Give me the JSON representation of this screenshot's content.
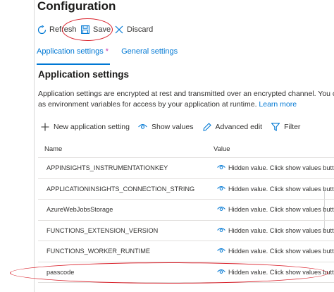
{
  "page": {
    "title": "Configuration",
    "section_title": "Application settings",
    "description": "Application settings are encrypted at rest and transmitted over an encrypted channel. You can",
    "description_line2": "as environment variables for access by your application at runtime.",
    "learn_more": "Learn more"
  },
  "toolbar": {
    "refresh_label": "Refresh",
    "save_label": "Save",
    "discard_label": "Discard"
  },
  "tabs": [
    {
      "label": "Application settings",
      "marker": "*",
      "active": true
    },
    {
      "label": "General settings",
      "active": false
    }
  ],
  "actions": {
    "new_label": "New application setting",
    "show_values_label": "Show values",
    "advanced_edit_label": "Advanced edit",
    "filter_label": "Filter"
  },
  "grid": {
    "columns": [
      "Name",
      "Value"
    ],
    "rows": [
      {
        "name": "APPINSIGHTS_INSTRUMENTATIONKEY",
        "value": "Hidden value. Click show values butto"
      },
      {
        "name": "APPLICATIONINSIGHTS_CONNECTION_STRING",
        "value": "Hidden value. Click show values butto"
      },
      {
        "name": "AzureWebJobsStorage",
        "value": "Hidden value. Click show values butto"
      },
      {
        "name": "FUNCTIONS_EXTENSION_VERSION",
        "value": "Hidden value. Click show values butto"
      },
      {
        "name": "FUNCTIONS_WORKER_RUNTIME",
        "value": "Hidden value. Click show values butto"
      },
      {
        "name": "passcode",
        "value": "Hidden value. Click show values butto"
      }
    ]
  },
  "colors": {
    "accent": "#0078d4",
    "annotation": "#d9202a",
    "marker": "#c239b3"
  },
  "icons": [
    "refresh-icon",
    "save-icon",
    "discard-icon",
    "plus-icon",
    "eye-icon",
    "edit-icon",
    "filter-icon"
  ]
}
